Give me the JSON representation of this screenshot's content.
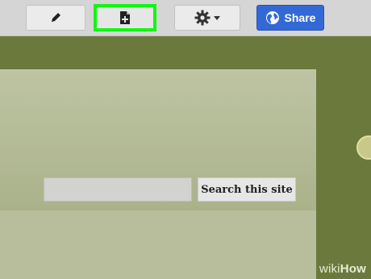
{
  "toolbar": {
    "edit_icon": "pencil-icon",
    "new_page_icon": "new-page-icon",
    "settings_icon": "gear-icon",
    "share_label": "Share",
    "share_icon": "globe-icon",
    "highlight_color": "#11f711",
    "share_color": "#3369d6"
  },
  "site": {
    "search_input_value": "",
    "search_button_label": "Search this site"
  },
  "watermark": {
    "part1": "wiki",
    "part2": "How"
  }
}
